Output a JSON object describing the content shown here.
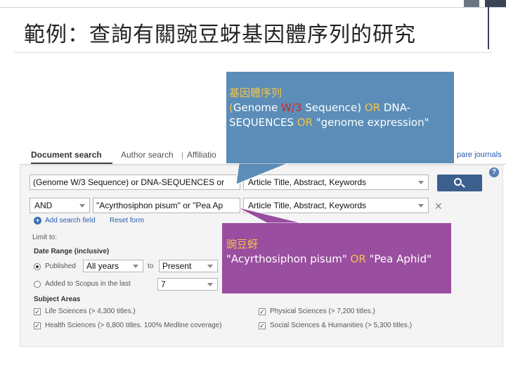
{
  "slide": {
    "title": "範例：查詢有關豌豆蚜基因體序列的研究"
  },
  "colors": {
    "blue_callout": "#5b8db8",
    "purple_callout": "#9a4ea0",
    "accent_yellow": "#f3c24a",
    "accent_red": "#d42020",
    "search_button": "#3d5f8e"
  },
  "callouts": {
    "blue": {
      "heading": "基因體序列",
      "open_paren": "(",
      "term1": "Genome ",
      "w3": "W/3",
      "term1b": " Sequence)",
      "op1": " OR ",
      "term2": "DNA-SEQUENCES",
      "op2": " OR ",
      "term3": "\"genome expression\""
    },
    "purple": {
      "heading": "豌豆蚜",
      "term1": "\"Acyrthosiphon pisum\"",
      "op": " OR ",
      "term2": "\"Pea Aphid\""
    }
  },
  "search_ui": {
    "tabs": [
      {
        "label": "Document search"
      },
      {
        "label": "Author search"
      },
      {
        "label": "|"
      },
      {
        "label": "Affiliatio"
      }
    ],
    "compare_link": "pare journals",
    "help_icon": "?",
    "rows": [
      {
        "query": "(Genome W/3 Sequence) or DNA-SEQUENCES or",
        "field": "Article Title, Abstract, Keywords"
      },
      {
        "operator": "AND",
        "query": "\"Acyrthosiphon pisum\" or \"Pea Ap",
        "field": "Article Title, Abstract, Keywords"
      }
    ],
    "add_field": "Add search field",
    "reset_form": "Reset form",
    "limit_label": "Limit to:",
    "date_range": {
      "label": "Date Range (inclusive)",
      "published_label": "Published",
      "from": "All years",
      "to_label": "to",
      "to": "Present",
      "added_label": "Added to Scopus in the last",
      "added_days": "7"
    },
    "subject_areas": {
      "label": "Subject Areas",
      "items": [
        {
          "label": "Life Sciences (> 4,300 titles.)",
          "checked": true
        },
        {
          "label": "Physical Sciences (> 7,200 titles.)",
          "checked": true
        },
        {
          "label": "Health Sciences (> 6,800 titles. 100% Medline coverage)",
          "checked": true
        },
        {
          "label": "Social Sciences & Humanities (> 5,300 titles.)",
          "checked": true
        }
      ]
    }
  }
}
